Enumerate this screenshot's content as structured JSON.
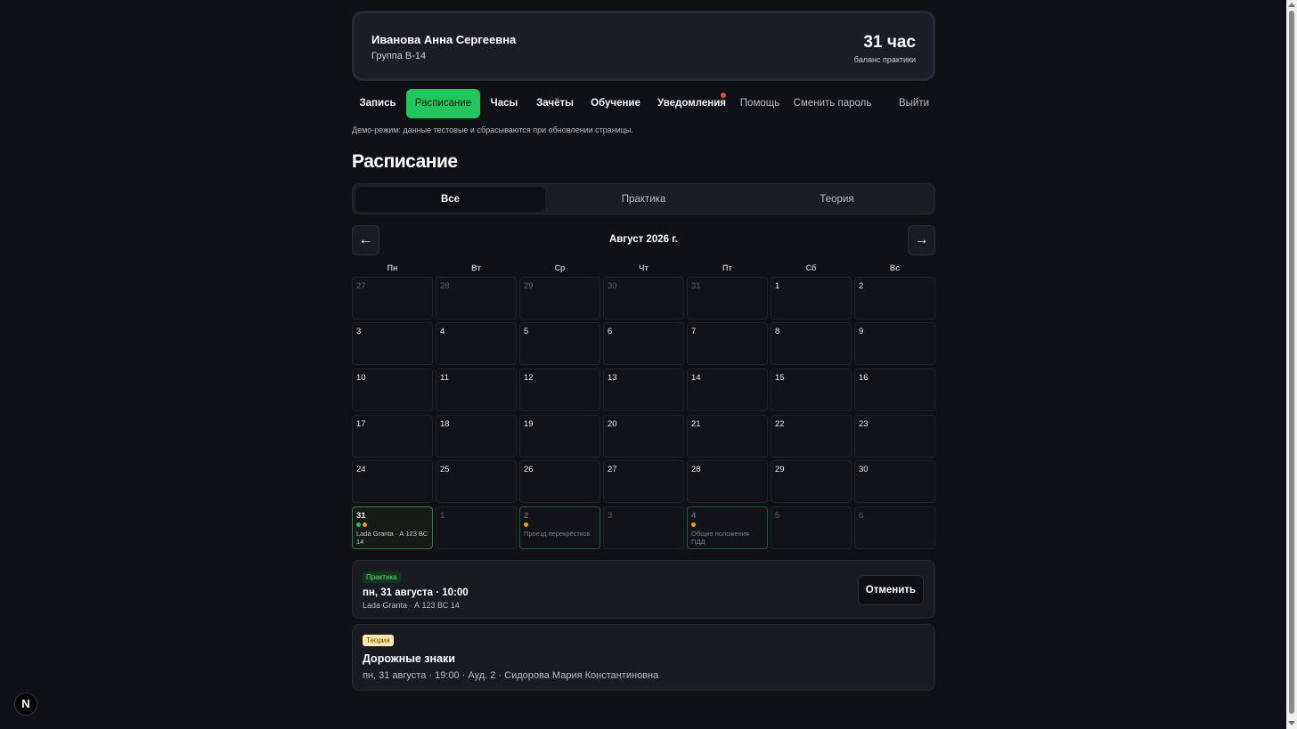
{
  "profile": {
    "name": "Иванова Анна Сергеевна",
    "group": "Группа B-14",
    "balance_value": "31 час",
    "balance_label": "баланс практики"
  },
  "nav": {
    "items": [
      {
        "label": "Запись",
        "state": "normal"
      },
      {
        "label": "Расписание",
        "state": "active"
      },
      {
        "label": "Часы",
        "state": "normal"
      },
      {
        "label": "Зачёты",
        "state": "normal"
      },
      {
        "label": "Обучение",
        "state": "normal"
      },
      {
        "label": "Уведомления",
        "state": "normal",
        "has_notification": true
      },
      {
        "label": "Помощь",
        "state": "muted"
      },
      {
        "label": "Сменить пароль",
        "state": "muted"
      },
      {
        "label": "Выйти",
        "state": "muted"
      }
    ]
  },
  "demo_note": "Демо-режим: данные тестовые и сбрасываются при обновлении страницы.",
  "page_title": "Расписание",
  "filter": {
    "tabs": [
      {
        "label": "Все",
        "active": true
      },
      {
        "label": "Практика",
        "active": false
      },
      {
        "label": "Теория",
        "active": false
      }
    ]
  },
  "calendar": {
    "month_label": "Август 2026 г.",
    "prev_icon": "arrow-left-icon",
    "next_icon": "arrow-right-icon",
    "prev_glyph": "←",
    "next_glyph": "→",
    "weekdays": [
      "Пн",
      "Вт",
      "Ср",
      "Чт",
      "Пт",
      "Сб",
      "Вс"
    ],
    "weeks": [
      [
        {
          "d": "27",
          "o": true
        },
        {
          "d": "28",
          "o": true
        },
        {
          "d": "29",
          "o": true
        },
        {
          "d": "30",
          "o": true
        },
        {
          "d": "31",
          "o": true
        },
        {
          "d": "1"
        },
        {
          "d": "2"
        }
      ],
      [
        {
          "d": "3"
        },
        {
          "d": "4"
        },
        {
          "d": "5"
        },
        {
          "d": "6"
        },
        {
          "d": "7"
        },
        {
          "d": "8"
        },
        {
          "d": "9"
        }
      ],
      [
        {
          "d": "10"
        },
        {
          "d": "11"
        },
        {
          "d": "12"
        },
        {
          "d": "13"
        },
        {
          "d": "14"
        },
        {
          "d": "15"
        },
        {
          "d": "16"
        }
      ],
      [
        {
          "d": "17"
        },
        {
          "d": "18"
        },
        {
          "d": "19"
        },
        {
          "d": "20"
        },
        {
          "d": "21"
        },
        {
          "d": "22"
        },
        {
          "d": "23"
        }
      ],
      [
        {
          "d": "24"
        },
        {
          "d": "25"
        },
        {
          "d": "26"
        },
        {
          "d": "27"
        },
        {
          "d": "28"
        },
        {
          "d": "29"
        },
        {
          "d": "30"
        }
      ],
      [
        {
          "d": "31",
          "selected": true,
          "dots": [
            "#22c55e",
            "#f59e0b"
          ],
          "sub": "Lada Granta · А 123 ВС 14"
        },
        {
          "d": "1",
          "o": true
        },
        {
          "d": "2",
          "o": true,
          "hl": true,
          "dots": [
            "#f59e0b"
          ],
          "sub": "Проезд перекрёстков"
        },
        {
          "d": "3",
          "o": true
        },
        {
          "d": "4",
          "o": true,
          "hl": true,
          "dots": [
            "#f59e0b"
          ],
          "sub": "Общие положения ПДД"
        },
        {
          "d": "5",
          "o": true
        },
        {
          "d": "6",
          "o": true
        }
      ]
    ]
  },
  "events": [
    {
      "badge": "Практика",
      "type": "practice",
      "title": "пн, 31 августа · 10:00",
      "subtitle": "Lada Granta · А 123 ВС 14",
      "action": "Отменить"
    },
    {
      "badge": "Теория",
      "type": "theory",
      "title": "Дорожные знаки",
      "subtitle": "пн, 31 августа · 19:00 · Ауд. 2 · Сидорова Мария Константиновна"
    }
  ],
  "dev_badge": {
    "glyph": "N",
    "icon": "nextjs-logo-icon"
  },
  "colors": {
    "accent": "#22c55e",
    "theory_dot": "#f59e0b",
    "notification": "#ef4444"
  }
}
